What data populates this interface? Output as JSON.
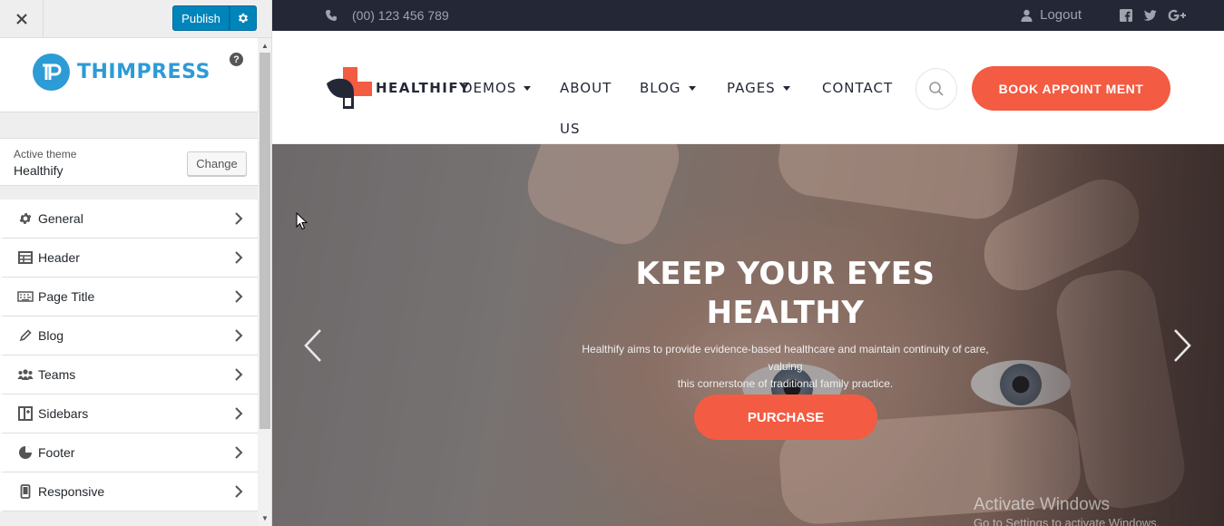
{
  "customizer": {
    "close_label": "✕",
    "publish_label": "Publish",
    "help_label": "?",
    "logo_text": "THIMPRESS",
    "active_theme_label": "Active theme",
    "active_theme_name": "Healthify",
    "change_label": "Change",
    "sections": [
      {
        "label": "General",
        "icon": "gear-icon"
      },
      {
        "label": "Header",
        "icon": "table-icon"
      },
      {
        "label": "Page Title",
        "icon": "keyboard-icon"
      },
      {
        "label": "Blog",
        "icon": "pencil-icon"
      },
      {
        "label": "Teams",
        "icon": "users-icon"
      },
      {
        "label": "Sidebars",
        "icon": "sidebars-icon"
      },
      {
        "label": "Footer",
        "icon": "footer-icon"
      },
      {
        "label": "Responsive",
        "icon": "mobile-icon"
      }
    ]
  },
  "site": {
    "topbar": {
      "phone": "(00) 123 456 789",
      "logout": "Logout",
      "social": [
        "facebook-icon",
        "twitter-icon",
        "google-plus-icon"
      ]
    },
    "brand": "HEALTHIFY",
    "nav": {
      "demos": "DEMOS",
      "about": "ABOUT",
      "blog": "BLOG",
      "pages": "PAGES",
      "contact": "CONTACT",
      "us": "US"
    },
    "book_label": "BOOK APPOINT MENT",
    "hero": {
      "title_line1": "KEEP YOUR EYES",
      "title_line2": "HEALTHY",
      "subtitle_line1": "Healthify aims to provide evidence-based healthcare and maintain continuity of care, valuing",
      "subtitle_line2": "this cornerstone of traditional family practice.",
      "cta": "PURCHASE"
    }
  },
  "watermark": {
    "line1": "Activate Windows",
    "line2": "Go to Settings to activate Windows."
  },
  "colors": {
    "accent": "#f35b42",
    "wp_blue": "#0085ba",
    "thim_blue": "#2d9bd6",
    "topbar": "#242836"
  }
}
